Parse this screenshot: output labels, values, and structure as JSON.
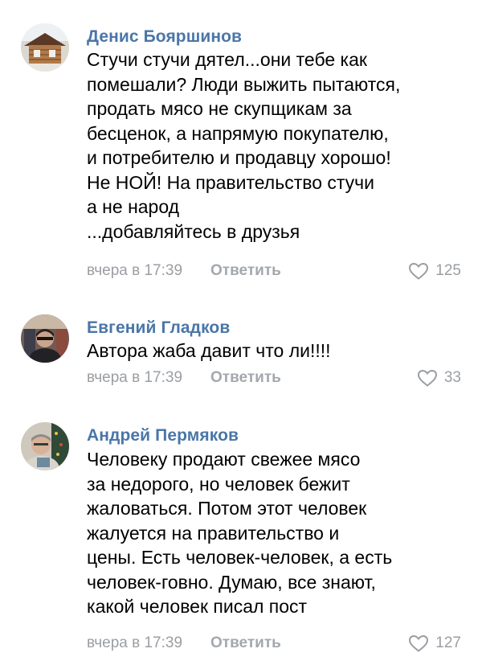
{
  "comments": [
    {
      "author": "Денис Бояршинов",
      "lines": [
        "Стучи стучи дятел...они тебе как",
        "помешали? Люди выжить пытаются,",
        "продать мясо не скупщикам за",
        "бесценок, а напрямую покупателю,",
        "и потребителю и продавцу хорошо!",
        "Не НОЙ! На правительство стучи",
        "а не народ",
        "...добавляйтесь в друзья"
      ],
      "time": "вчера в 17:39",
      "reply": "Ответить",
      "likes": "125",
      "avatar_icon": "house-photo-avatar"
    },
    {
      "author": "Евгений Гладков",
      "lines": [
        "Автора жаба давит что ли!!!!"
      ],
      "time": "вчера в 17:39",
      "reply": "Ответить",
      "likes": "33",
      "avatar_icon": "person-photo-avatar"
    },
    {
      "author": "Андрей Пермяков",
      "lines": [
        "Человеку продают свежее мясо",
        "за недорого, но человек бежит",
        "жаловаться. Потом этот человек",
        "жалуется на правительство и",
        "цены. Есть человек-человек, а есть",
        "человек-говно. Думаю, все знают,",
        "какой человек писал пост"
      ],
      "time": "вчера в 17:39",
      "reply": "Ответить",
      "likes": "127",
      "avatar_icon": "person-photo-avatar"
    }
  ],
  "colors": {
    "author": "#4a76a8",
    "meta": "#9a9ea3",
    "text": "#000000"
  },
  "icons": {
    "like": "heart-outline-icon"
  }
}
